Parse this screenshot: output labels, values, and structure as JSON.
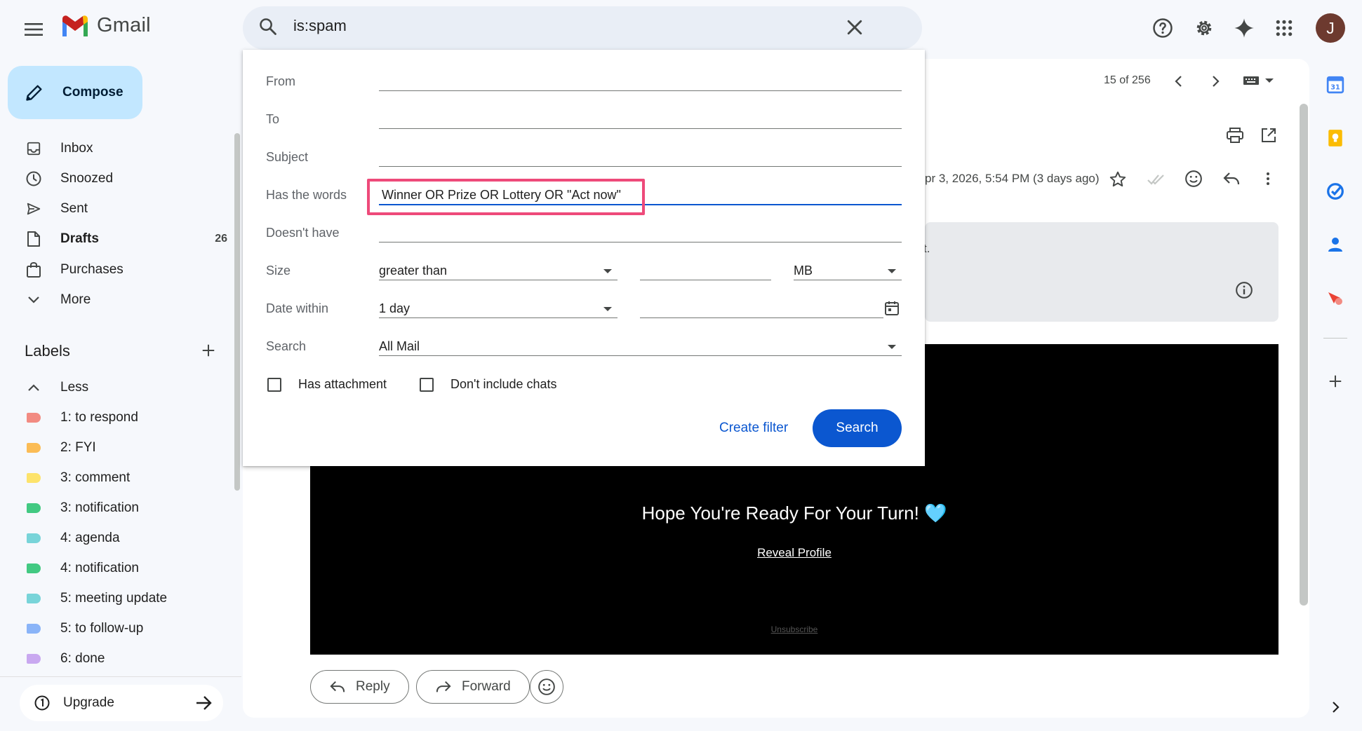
{
  "app": {
    "name": "Gmail"
  },
  "search": {
    "query": "is:spam"
  },
  "header": {
    "avatar_initial": "J"
  },
  "sidebar": {
    "compose_label": "Compose",
    "items": [
      {
        "label": "Inbox",
        "icon": "inbox-icon"
      },
      {
        "label": "Snoozed",
        "icon": "clock-icon"
      },
      {
        "label": "Sent",
        "icon": "send-icon"
      },
      {
        "label": "Drafts",
        "icon": "draft-icon",
        "count": "26"
      },
      {
        "label": "Purchases",
        "icon": "bag-icon"
      },
      {
        "label": "More",
        "icon": "chevron-down-icon"
      }
    ],
    "labels_title": "Labels",
    "less_label": "Less",
    "labels": [
      {
        "name": "1: to respond",
        "color": "#f28b82"
      },
      {
        "name": "2: FYI",
        "color": "#fbbc55"
      },
      {
        "name": "3: comment",
        "color": "#fde36b"
      },
      {
        "name": "3: notification",
        "color": "#42c982"
      },
      {
        "name": "4: agenda",
        "color": "#78d4d9"
      },
      {
        "name": "4: notification",
        "color": "#42c982"
      },
      {
        "name": "5: meeting update",
        "color": "#78d4d9"
      },
      {
        "name": "5: to follow-up",
        "color": "#8ab4f8"
      },
      {
        "name": "6: done",
        "color": "#c9a8f0"
      }
    ],
    "upgrade_label": "Upgrade"
  },
  "main": {
    "pager": "15 of 256",
    "date": "pr 3, 2026, 5:54 PM (3 days ago)",
    "notice_text": "t.",
    "email_title": "Hope You're Ready For Your Turn! 🩵",
    "email_link": "Reveal Profile",
    "email_unsubscribe": "Unsubscribe",
    "reply_label": "Reply",
    "forward_label": "Forward"
  },
  "search_options": {
    "from_label": "From",
    "to_label": "To",
    "subject_label": "Subject",
    "has_words_label": "Has the words",
    "has_words_value": "Winner OR Prize OR Lottery OR \"Act now\"",
    "doesnt_have_label": "Doesn't have",
    "size_label": "Size",
    "size_operator": "greater than",
    "size_unit": "MB",
    "date_within_label": "Date within",
    "date_within_value": "1 day",
    "search_label": "Search",
    "search_scope": "All Mail",
    "has_attachment_label": "Has attachment",
    "dont_include_chats_label": "Don't include chats",
    "create_filter_label": "Create filter",
    "search_button_label": "Search"
  },
  "colors": {
    "accent": "#0b57d0",
    "compose_bg": "#c2e7ff",
    "highlight": "#ee4a7a"
  }
}
